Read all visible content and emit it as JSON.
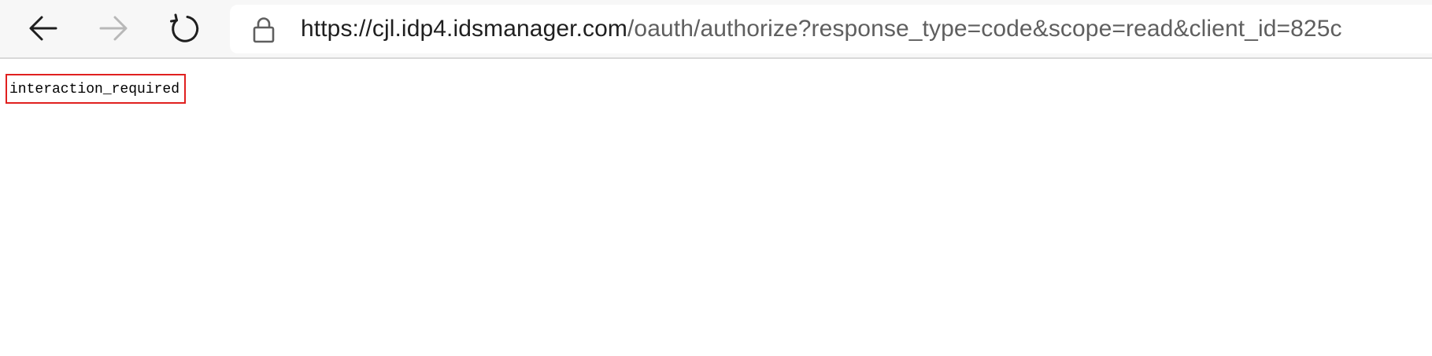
{
  "browser": {
    "icons": {
      "back": "back-arrow-icon",
      "forward": "forward-arrow-icon",
      "reload": "reload-icon",
      "lock": "lock-icon"
    },
    "forward_enabled": false,
    "address_bar": {
      "url_prefix": "https://",
      "url_host": "cjl.idp4.idsmanager.com",
      "url_path": "/oauth/authorize?response_type=code&scope=read&client_id=825c"
    }
  },
  "page": {
    "body_text": "interaction_required",
    "highlight_color": "#e0201f"
  }
}
